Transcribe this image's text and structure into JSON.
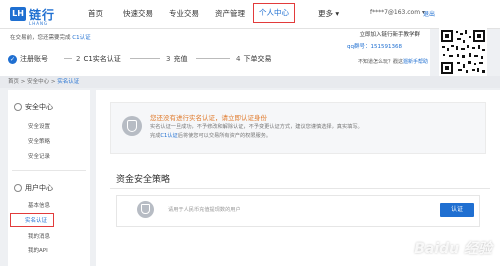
{
  "header": {
    "logo_text": "链行",
    "logo_sub": "LHANG",
    "nav": [
      "首页",
      "快速交易",
      "专业交易",
      "资产管理",
      "个人中心",
      "更多 ▾"
    ],
    "active_nav": "个人中心",
    "user_email": "f****7@163.com ▾",
    "exit_label": "退出"
  },
  "subheader": {
    "notice_text": "在交易前，您还需要完成",
    "notice_link": "C1认证",
    "steps": [
      {
        "num": "",
        "label": "注册账号"
      },
      {
        "num": "2",
        "label": "C1实名认证"
      },
      {
        "num": "3",
        "label": "充值"
      },
      {
        "num": "4",
        "label": "下单交易"
      }
    ],
    "join_text": "立即加入链行新手教学群",
    "qq_text": "qq群号：151591368",
    "find_text": "不知道怎么玩？戳这",
    "find_link": "遛新手帮助"
  },
  "breadcrumb": {
    "items": [
      "首页",
      "安全中心"
    ],
    "current": "实名认证",
    "separator": ">"
  },
  "sidebar": {
    "security_header": "安全中心",
    "security_items": [
      "安全设置",
      "安全策略",
      "安全记录"
    ],
    "user_header": "用户中心",
    "user_items": [
      "基本信息",
      "实名认证",
      "我的消息",
      "我的API"
    ],
    "active_item": "实名认证"
  },
  "main": {
    "warning_title": "您还没有进行实名认证，请立即认证身份",
    "warning_line1": "实名认证一旦成功，不予修改和解除认证，不予变更认证方式，建议您谨慎选择，真实填写。",
    "warning_line2_a": "完成",
    "warning_line2_link": "C1认证",
    "warning_line2_b": "后将使您可以交易所有资产的权限服务。",
    "section_title": "资金安全策略",
    "kyc_text": "请用于人民币充值提现数的用户",
    "kyc_button": "认证"
  },
  "watermark": "Baidu 经验",
  "colors": {
    "accent": "#1f6fd1",
    "highlight": "#e23b3b",
    "warning": "#e07a2b"
  }
}
